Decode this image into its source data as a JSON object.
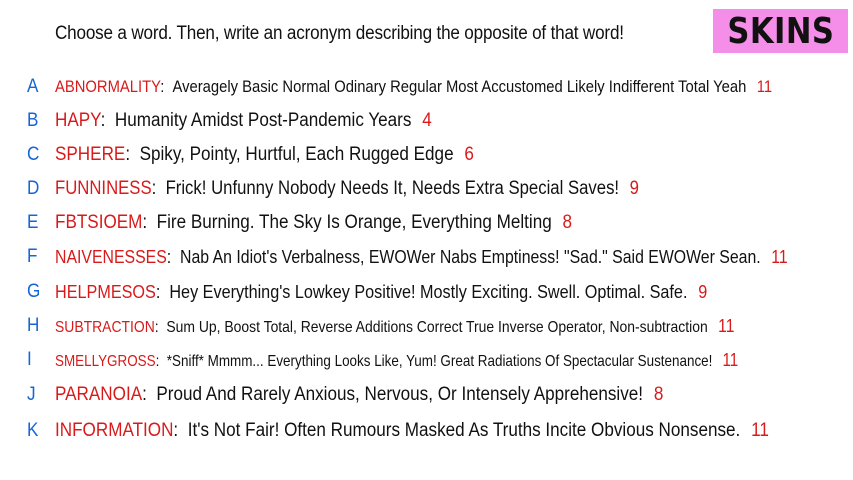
{
  "prompt": "Choose a word. Then, write an acronym describing the opposite of that word!",
  "badge": "SKINS",
  "entries": [
    {
      "letter": "A",
      "word": "ABNORMALITY",
      "acronym": "Averagely Basic Normal Odinary Regular Most Accustomed Likely Indifferent Total Yeah",
      "count": "11"
    },
    {
      "letter": "B",
      "word": "HAPY",
      "acronym": "Humanity Amidst Post-Pandemic Years",
      "count": "4"
    },
    {
      "letter": "C",
      "word": "SPHERE",
      "acronym": "Spiky, Pointy, Hurtful, Each Rugged Edge",
      "count": "6"
    },
    {
      "letter": "D",
      "word": "FUNNINESS",
      "acronym": "Frick! Unfunny Nobody Needs It, Needs Extra Special Saves!",
      "count": "9"
    },
    {
      "letter": "E",
      "word": "FBTSIOEM",
      "acronym": "Fire Burning. The Sky Is Orange, Everything Melting",
      "count": "8"
    },
    {
      "letter": "F",
      "word": "NAIVENESSES",
      "acronym": "Nab An Idiot's Verbalness, EWOWer Nabs Emptiness! \"Sad.\" Said EWOWer Sean.",
      "count": "11"
    },
    {
      "letter": "G",
      "word": "HELPMESOS",
      "acronym": "Hey Everything's Lowkey Positive! Mostly Exciting. Swell. Optimal. Safe.",
      "count": "9"
    },
    {
      "letter": "H",
      "word": "SUBTRACTION",
      "acronym": "Sum Up, Boost Total, Reverse Additions Correct True Inverse Operator, Non-subtraction",
      "count": "11"
    },
    {
      "letter": "I",
      "word": "SMELLYGROSS",
      "acronym": "*Sniff* Mmmm... Everything Looks Like, Yum! Great Radiations Of Spectacular Sustenance!",
      "count": "11"
    },
    {
      "letter": "J",
      "word": "PARANOIA",
      "acronym": "Proud And Rarely Anxious, Nervous, Or Intensely Apprehensive!",
      "count": "8"
    },
    {
      "letter": "K",
      "word": "INFORMATION",
      "acronym": "It's Not Fair! Often Rumours Masked As Truths Incite Obvious Nonsense.",
      "count": "11"
    }
  ]
}
